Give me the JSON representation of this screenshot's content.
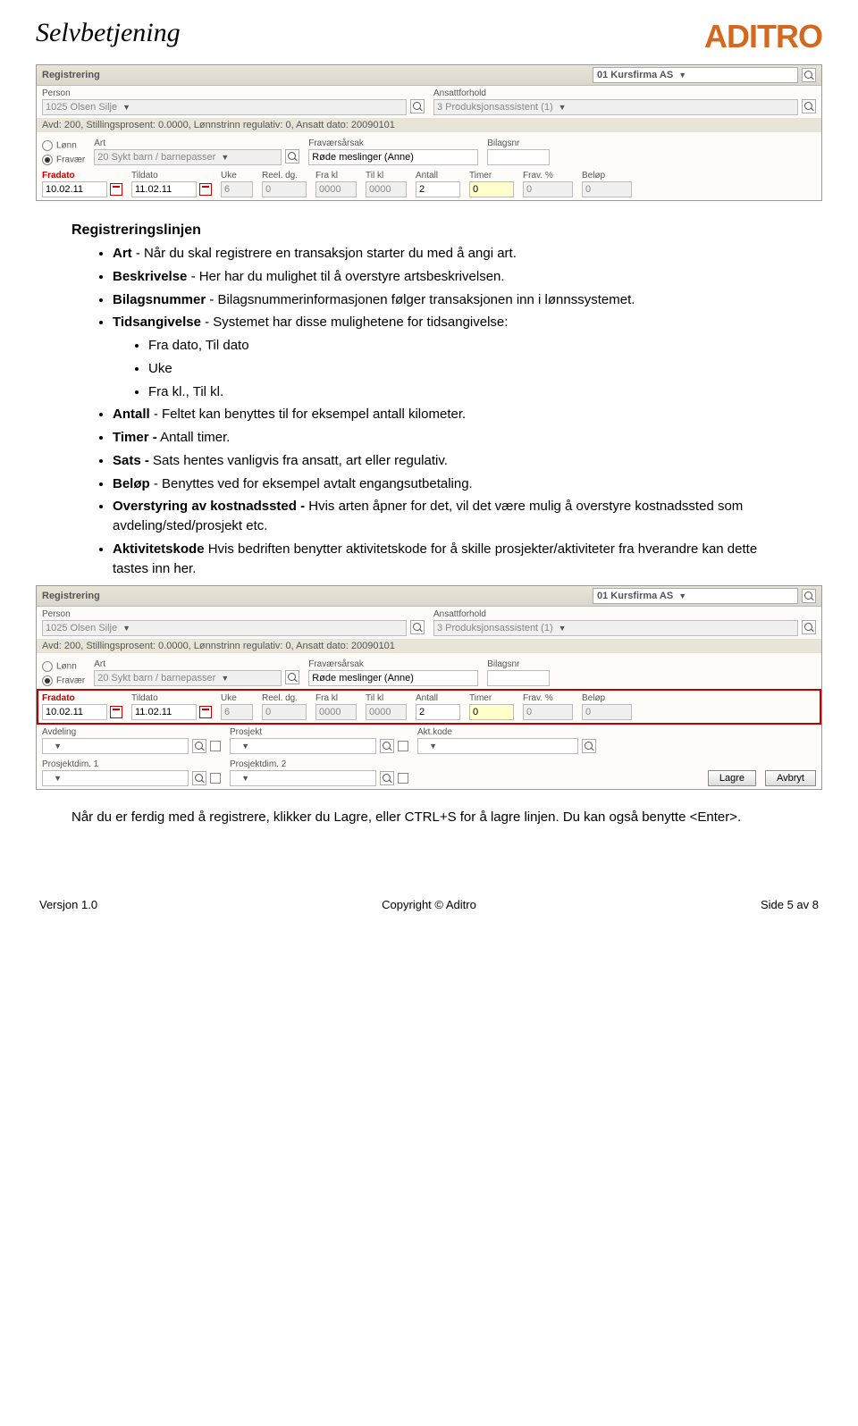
{
  "header": {
    "title": "Selvbetjening",
    "logo": "ADITRO"
  },
  "panel": {
    "title": "Registrering",
    "company": "01 Kursfirma AS",
    "person_label": "Person",
    "person": "1025 Olsen Silje",
    "ansatt_label": "Ansattforhold",
    "ansatt": "3 Produksjonsassistent (1)",
    "avd_line": "Avd: 200, Stillingsprosent: 0.0000, Lønnstrinn regulativ: 0, Ansatt dato: 20090101",
    "lonn": "Lønn",
    "fravaer": "Fravær",
    "art_label": "Art",
    "art": "20 Sykt barn / barnepasser",
    "fravarsak_label": "Fraværsårsak",
    "fravarsak": "Røde meslinger (Anne)",
    "bilagsnr_label": "Bilagsnr",
    "fradato_label": "Fradato",
    "fradato": "10.02.11",
    "tildato_label": "Tildato",
    "tildato": "11.02.11",
    "uke_label": "Uke",
    "uke": "6",
    "reeldg_label": "Reel. dg.",
    "reeldg": "0",
    "frakl_label": "Fra kl",
    "frakl": "0000",
    "tilkl_label": "Til kl",
    "tilkl": "0000",
    "antall_label": "Antall",
    "antall": "2",
    "timer_label": "Timer",
    "timer": "0",
    "fravpct_label": "Frav. %",
    "fravpct": "0",
    "belop_label": "Beløp",
    "belop": "0",
    "avdeling_label": "Avdeling",
    "prosjekt_label": "Prosjekt",
    "aktkode_label": "Akt.kode",
    "pd1_label": "Prosjektdim. 1",
    "pd2_label": "Prosjektdim. 2",
    "lagre": "Lagre",
    "avbryt": "Avbryt"
  },
  "text": {
    "heading": "Registreringslinjen",
    "b1_strong": "Art",
    "b1_rest": " - Når du skal registrere en transaksjon starter du med å angi art.",
    "b2_strong": "Beskrivelse",
    "b2_rest": " - Her har du mulighet til å overstyre artsbeskrivelsen.",
    "b3_strong": "Bilagsnummer",
    "b3_rest": " - Bilagsnummerinformasjonen følger transaksjonen inn i lønnssystemet.",
    "b4_strong": "Tidsangivelse",
    "b4_rest": " - Systemet har disse mulighetene for tidsangivelse:",
    "b4s1": "Fra dato, Til dato",
    "b4s2": "Uke",
    "b4s3": "Fra kl., Til kl.",
    "b5_strong": "Antall",
    "b5_rest": " - Feltet kan benyttes til for eksempel antall kilometer.",
    "b6_strong": "Timer -",
    "b6_rest": " Antall timer.",
    "b7_strong": "Sats -",
    "b7_rest": " Sats hentes vanligvis fra ansatt, art eller regulativ.",
    "b8_strong": "Beløp",
    "b8_rest": " - Benyttes ved for eksempel avtalt engangsutbetaling.",
    "b9_strong": "Overstyring av kostnadssted -",
    "b9_rest": " Hvis arten åpner for det, vil det være mulig å overstyre kostnadssted som avdeling/sted/prosjekt etc.",
    "b10_strong": "Aktivitetskode",
    "b10_rest": " Hvis bedriften benytter aktivitetskode for å skille prosjekter/aktiviteter fra hverandre kan dette tastes inn her.",
    "final_para": "Når du er ferdig med å registrere, klikker du Lagre, eller CTRL+S for å lagre linjen. Du kan også benytte <Enter>."
  },
  "footer": {
    "left": "Versjon 1.0",
    "center": "Copyright © Aditro",
    "right": "Side 5 av 8"
  }
}
